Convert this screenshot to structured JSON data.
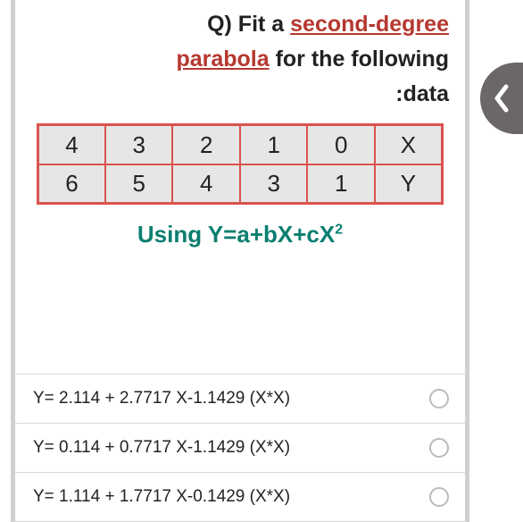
{
  "question": {
    "prefix": "Q) Fit a ",
    "link1": "second-degree",
    "link2": "parabola",
    "mid": " for the following",
    "suffix": ":data"
  },
  "table": {
    "row1": [
      "4",
      "3",
      "2",
      "1",
      "0",
      "X"
    ],
    "row2": [
      "6",
      "5",
      "4",
      "3",
      "1",
      "Y"
    ]
  },
  "formula": {
    "prefix": "Using Y=a+bX+cX",
    "power": "2"
  },
  "options": [
    "Y= 2.114 + 2.7717 X-1.1429 (X*X)",
    "Y= 0.114 + 0.7717 X-1.1429 (X*X)",
    "Y= 1.114 + 1.7717 X-0.1429 (X*X)"
  ],
  "chart_data": {
    "type": "table",
    "columns": [
      "X",
      "Y"
    ],
    "rows": [
      {
        "X": 0,
        "Y": 1
      },
      {
        "X": 1,
        "Y": 3
      },
      {
        "X": 2,
        "Y": 4
      },
      {
        "X": 3,
        "Y": 5
      },
      {
        "X": 4,
        "Y": 6
      }
    ]
  }
}
